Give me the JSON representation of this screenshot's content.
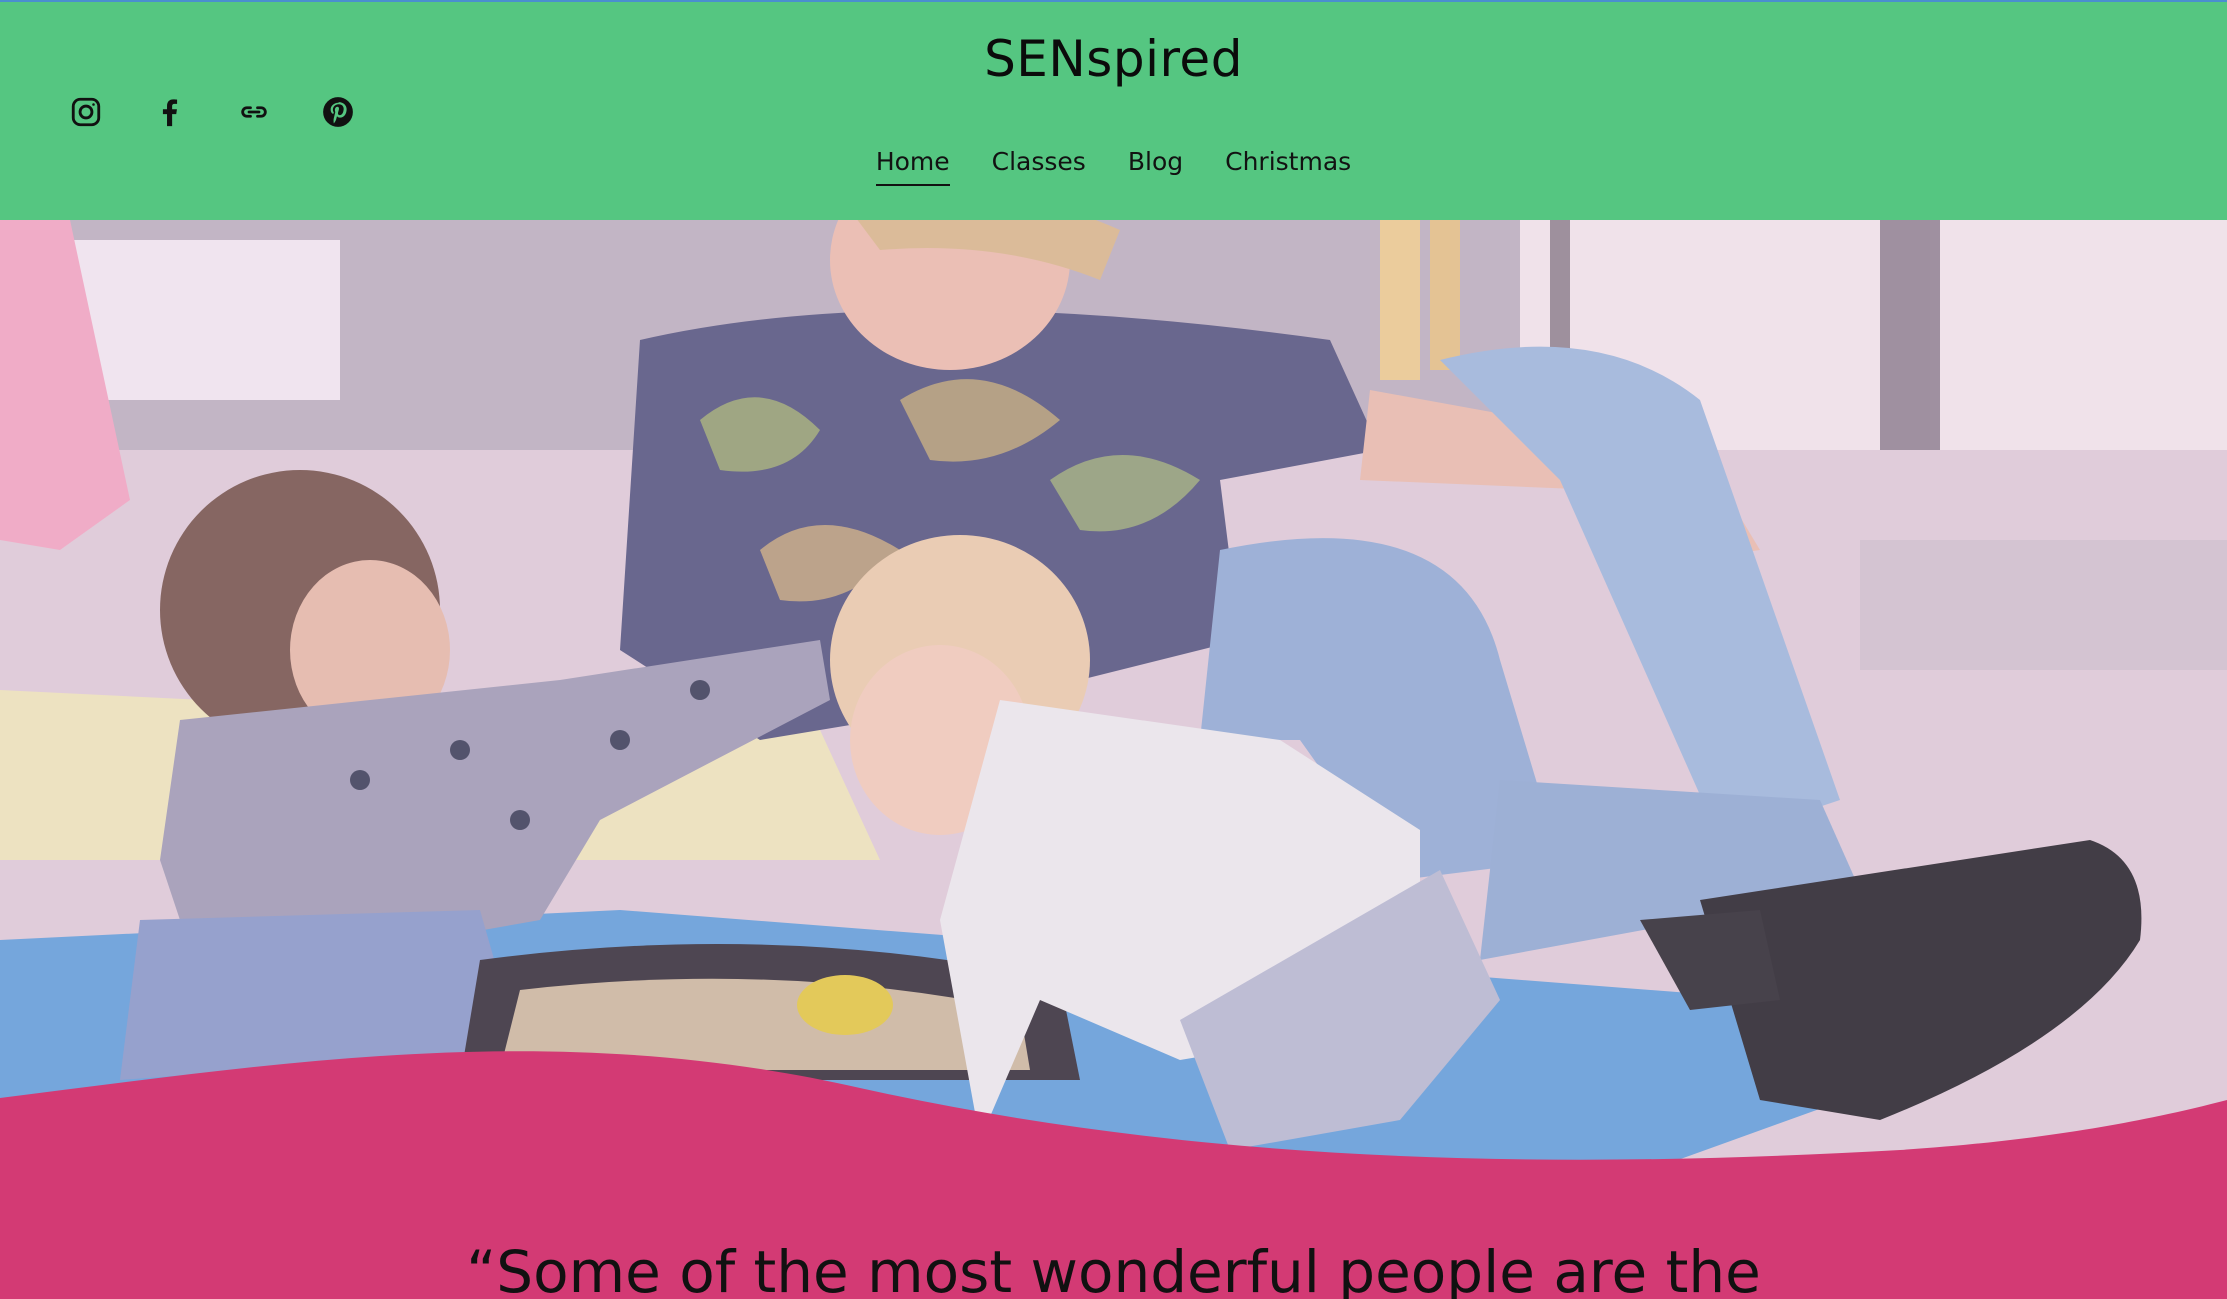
{
  "site": {
    "title": "SENspired"
  },
  "social": [
    {
      "name": "instagram-icon"
    },
    {
      "name": "facebook-icon"
    },
    {
      "name": "link-icon"
    },
    {
      "name": "pinterest-icon"
    }
  ],
  "nav": [
    {
      "label": "Home",
      "active": true
    },
    {
      "label": "Classes",
      "active": false
    },
    {
      "label": "Blog",
      "active": false
    },
    {
      "label": "Christmas",
      "active": false
    }
  ],
  "hero": {
    "image_subject": "adult playing on floor with two toddlers at sand tray"
  },
  "quote": {
    "text": "“Some of the most wonderful people are the"
  },
  "colors": {
    "header": "#55c681",
    "section": "#d33a74",
    "text": "#111111"
  }
}
